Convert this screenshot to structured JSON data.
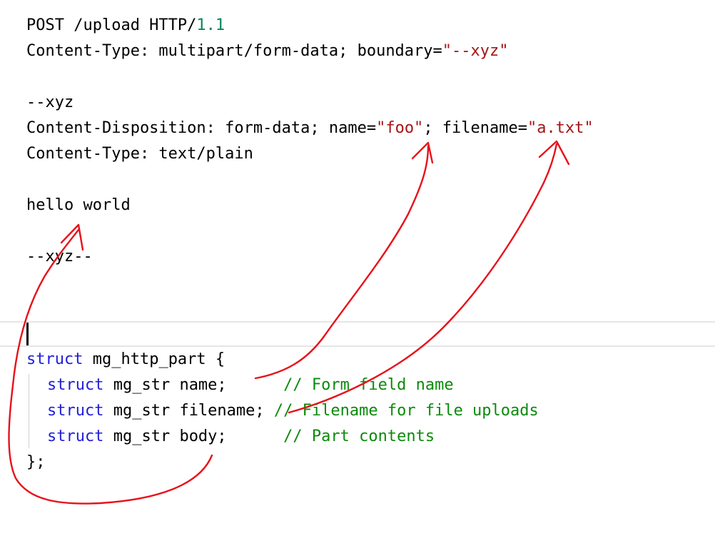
{
  "http_request": {
    "request_line": {
      "method_path": "POST /upload HTTP/",
      "version": "1.1"
    },
    "content_type_header": {
      "prefix": "Content-Type: multipart/form-data; boundary=",
      "boundary_value": "\"--xyz\""
    },
    "boundary_open": "--xyz",
    "disposition_header": {
      "prefix": "Content-Disposition: form-data; name=",
      "name_value": "\"foo\"",
      "middle": "; filename=",
      "filename_value": "\"a.txt\""
    },
    "part_content_type": "Content-Type: text/plain",
    "body_text": "hello world",
    "boundary_close": "--xyz--"
  },
  "struct_code": {
    "open_keyword": "struct",
    "open_rest": " mg_http_part {",
    "fields": [
      {
        "keyword": "struct",
        "decl": " mg_str name;      ",
        "comment": "// Form field name"
      },
      {
        "keyword": "struct",
        "decl": " mg_str filename; ",
        "comment": "// Filename for file uploads"
      },
      {
        "keyword": "struct",
        "decl": " mg_str body;      ",
        "comment": "// Part contents"
      }
    ],
    "close": "};"
  },
  "colors": {
    "keyword": "#1f1fd8",
    "string": "#a31515",
    "number": "#098658",
    "comment": "#0b8a0b",
    "annotation": "#e8101a"
  }
}
